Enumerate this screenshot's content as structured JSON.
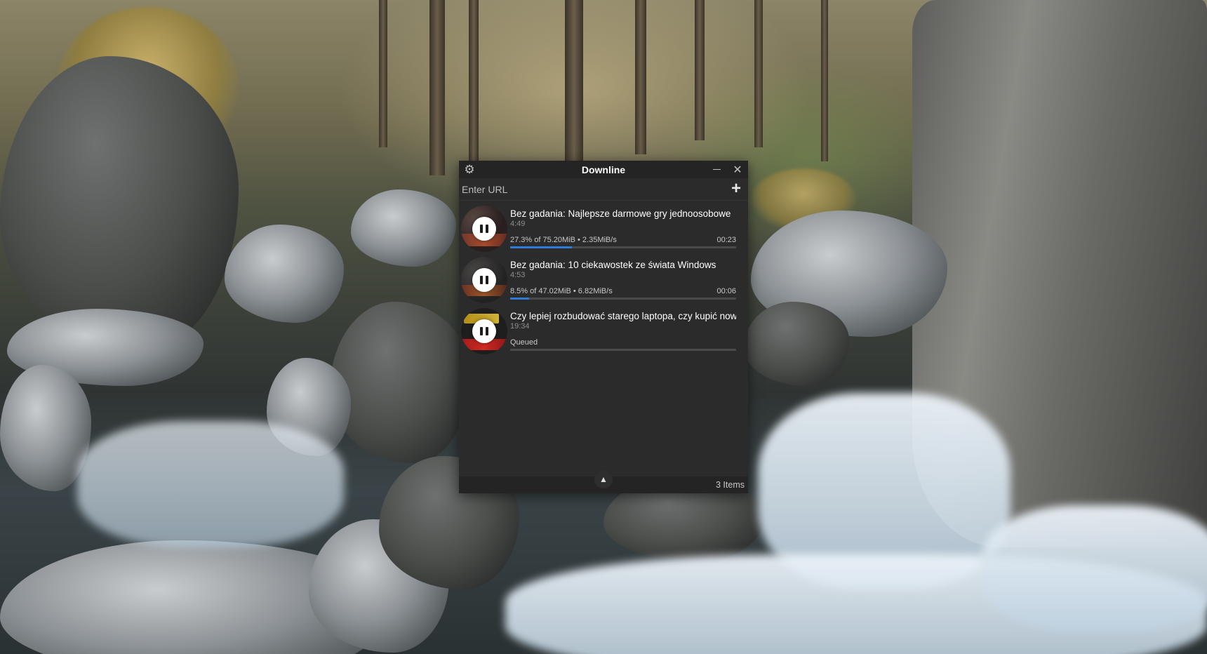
{
  "desktop": {
    "wallpaper": "forest stream with rocks and waterfall"
  },
  "window": {
    "title": "Downline",
    "icons": {
      "settings": "gear-icon",
      "minimize": "minimize-icon",
      "close": "close-icon",
      "add": "plus-icon",
      "collapse": "chevron-up-icon"
    },
    "close_glyph": "✕",
    "add_glyph": "+",
    "collapse_glyph": "▲"
  },
  "url_bar": {
    "placeholder": "Enter URL",
    "value": ""
  },
  "downloads": [
    {
      "title": "Bez gadania: Najlepsze darmowe gry jednoosobowe",
      "duration": "4:49",
      "status": "27.3% of 75.20MiB • 2.35MiB/s",
      "eta": "00:23",
      "progress": 0.273
    },
    {
      "title": "Bez gadania: 10 ciekawostek ze świata Windows",
      "duration": "4:53",
      "status": "8.5% of 47.02MiB • 6.82MiB/s",
      "eta": "00:06",
      "progress": 0.085
    },
    {
      "title": "Czy lepiej rozbudować starego laptopa, czy kupić nowy?",
      "duration": "19:34",
      "status": "Queued",
      "eta": "",
      "progress": 0
    }
  ],
  "footer": {
    "count": "3 Items"
  },
  "colors": {
    "progress": "#2e7bd6",
    "window_bg": "#2b2b2b",
    "titlebar_bg": "#242424"
  }
}
